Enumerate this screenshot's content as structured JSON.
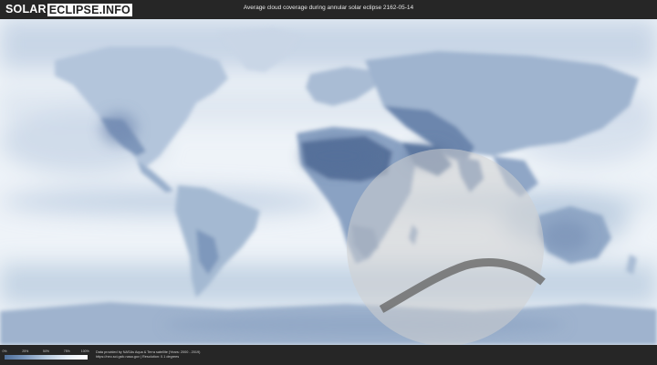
{
  "header": {
    "logo_left": "SOLAR",
    "logo_right": "ECLIPSE.INFO",
    "title": "Average cloud coverage during annular solar eclipse 2162-05-14"
  },
  "map": {
    "layer": "average-cloud-coverage",
    "projection": "equirectangular",
    "eclipse_visibility_region": "penumbra",
    "annularity_path": "central-path",
    "colors": {
      "ocean_clear": "#f2f6fa",
      "cloud_mid": "#b6c8dd",
      "cloud_dense": "#6b86ad",
      "land_dry": "#4d668f",
      "penumbra_fill": "#cfcfcf",
      "central_path": "#6f6f6f"
    }
  },
  "legend": {
    "ticks": [
      "0%",
      "25%",
      "50%",
      "75%",
      "100%"
    ]
  },
  "footer": {
    "credit_line1": "Data provided by NASAs Aqua & Terra satellite (Years: 2000 - 2019)",
    "credit_line2": "https://neo.sci.gsfc.nasa.gov | Resolution: 0.1 degrees"
  }
}
